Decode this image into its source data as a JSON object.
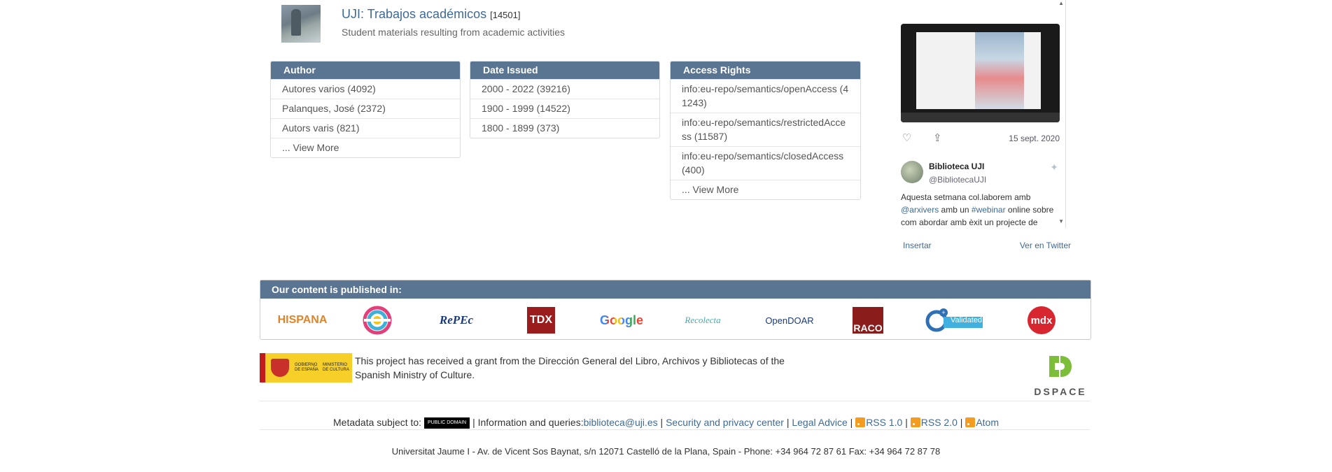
{
  "community": {
    "title": "UJI: Trabajos académicos",
    "count": "[14501]",
    "description": "Student materials resulting from academic activities"
  },
  "facets": [
    {
      "heading": "Author",
      "items": [
        "Autores varios (4092)",
        "Palanques, José (2372)",
        "Autors varis (821)"
      ],
      "view_more": "... View More"
    },
    {
      "heading": "Date Issued",
      "items": [
        "2000 - 2022 (39216)",
        "1900 - 1999 (14522)",
        "1800 - 1899 (373)"
      ]
    },
    {
      "heading": "Access Rights",
      "items": [
        "info:eu-repo/semantics/openAccess (41243)",
        "info:eu-repo/semantics/restrictedAccess (11587)",
        "info:eu-repo/semantics/closedAccess (400)"
      ],
      "view_more": "... View More"
    }
  ],
  "twitter": {
    "date": "15 sept. 2020",
    "name": "Biblioteca UJI",
    "handle": "@BibliotecaUJI",
    "text_1": "Aquesta setmana col.laborem amb ",
    "mention": "@arxivers",
    "text_2": " amb un ",
    "hashtag": "#webinar",
    "text_3": " online sobre com abordar amb èxit un projecte de",
    "embed": "Insertar",
    "view_on": "Ver en Twitter"
  },
  "published": {
    "heading": "Our content is published in:",
    "logos": [
      "HISPANA",
      "RePEc",
      "TDX",
      "Google",
      "Recolecta",
      "OpenDOAR",
      "RACO",
      "Validated",
      "mdx"
    ]
  },
  "grant": {
    "flag_left": "GOBIERNO DE ESPAÑA",
    "flag_right": "MINISTERIO DE CULTURA",
    "text": "This project has received a grant from the Dirección General del Libro, Archivos y Bibliotecas of the Spanish Ministry of Culture."
  },
  "dspace": "DSPACE",
  "footer": {
    "metadata": "Metadata subject to:",
    "cc_label": "PUBLIC DOMAIN",
    "info": " | Information and queries:",
    "email": "biblioteca@uji.es",
    "security": "Security and privacy center",
    "legal": "Legal Advice",
    "rss1": "RSS 1.0",
    "rss2": "RSS 2.0",
    "atom": "Atom",
    "address": "Universitat Jaume I - Av. de Vicent Sos Baynat, s/n 12071 Castelló de la Plana, Spain - Phone: +34 964 72 87 61 Fax: +34 964 72 87 78"
  },
  "colors": {
    "header_bg": "#5a7592",
    "link": "#3f6a96"
  },
  "icons": [
    "heart-icon",
    "share-icon",
    "twitter-bird-icon",
    "rss-icon",
    "cc-license-icon"
  ]
}
